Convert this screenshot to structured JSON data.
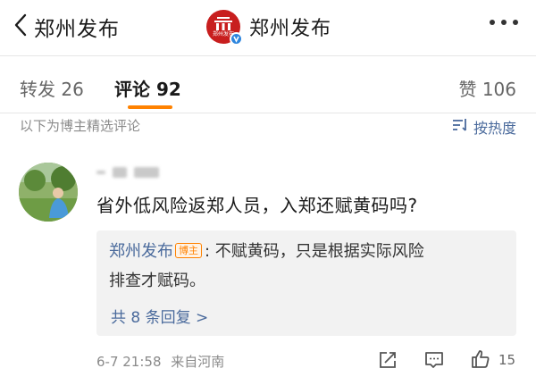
{
  "nav": {
    "back_label": "郑州发布",
    "title": "郑州发布",
    "logo_text": "郑州发布"
  },
  "tabs": {
    "forward": "转发 26",
    "comments": "评论 92",
    "likes": "赞 106"
  },
  "subheader": {
    "note": "以下为博主精选评论",
    "sort_label": "按热度"
  },
  "comment": {
    "text": "省外低风险返郑人员，入郑还赋黄码吗?",
    "time": "6-7 21:58",
    "location": "来自河南",
    "like_count": "15",
    "reply": {
      "author": "郑州发布",
      "badge": "博主",
      "text_line1": ": 不赋黄码，只是根据实际风险",
      "text_line2": "排查才赋码。",
      "more_label": "共 8 条回复 >"
    }
  },
  "colors": {
    "accent": "#ff8200",
    "link": "#4a6a9c",
    "brand_red": "#c81e1e",
    "verified_blue": "#2e86de"
  }
}
